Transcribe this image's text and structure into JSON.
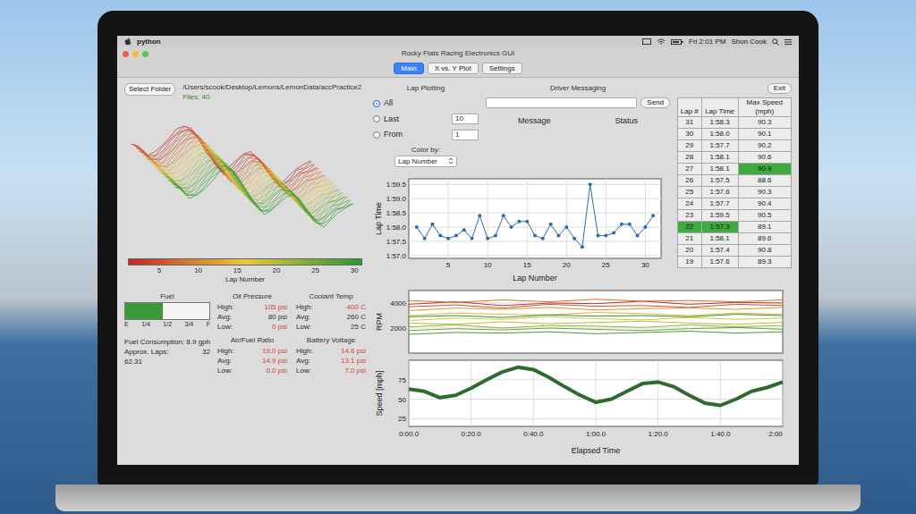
{
  "menubar": {
    "app": "python",
    "clock": "Fri 2:01 PM",
    "user": "Shon Cook"
  },
  "window": {
    "title": "Rocky Flats Racing Electronics GUI"
  },
  "tabs": [
    {
      "label": "Main",
      "selected": true
    },
    {
      "label": "X vs. Y Plot",
      "selected": false
    },
    {
      "label": "Settings",
      "selected": false
    }
  ],
  "folder": {
    "button": "Select Folder",
    "path": "/Users/scook/Desktop/Lemons/LemonData/accPractice2",
    "files": "Files: 40"
  },
  "colorbar": {
    "ticks": [
      "5",
      "10",
      "15",
      "20",
      "25",
      "30"
    ],
    "label": "Lap Number"
  },
  "fuel": {
    "title": "Fuel",
    "level": 0.45,
    "ticks": [
      "E",
      "1/4",
      "1/2",
      "3/4",
      "F"
    ],
    "consumption_label": "Fuel Consumption:",
    "consumption": "8.9 gph",
    "laps_label": "Approx. Laps:",
    "laps": "32",
    "remaining": "62.31"
  },
  "sensors": [
    {
      "title": "Oil Pressure",
      "stats": [
        {
          "label": "High:",
          "value": "105 psi",
          "alert": true
        },
        {
          "label": "Avg:",
          "value": "80 psi",
          "alert": false
        },
        {
          "label": "Low:",
          "value": "0 psi",
          "alert": true
        }
      ]
    },
    {
      "title": "Coolant Temp",
      "stats": [
        {
          "label": "High:",
          "value": "400 C",
          "alert": true
        },
        {
          "label": "Avg:",
          "value": "260 C",
          "alert": false
        },
        {
          "label": "Low:",
          "value": "25 C",
          "alert": false
        }
      ]
    },
    {
      "title": "Air/Fuel Ratio",
      "stats": [
        {
          "label": "High:",
          "value": "19.0 psi",
          "alert": true
        },
        {
          "label": "Avg:",
          "value": "14.9 psi",
          "alert": true
        },
        {
          "label": "Low:",
          "value": "0.0 psi",
          "alert": true
        }
      ]
    },
    {
      "title": "Battery Voltage",
      "stats": [
        {
          "label": "High:",
          "value": "14.6 psi",
          "alert": true
        },
        {
          "label": "Avg:",
          "value": "13.1 psi",
          "alert": true
        },
        {
          "label": "Low:",
          "value": "7.0 psi",
          "alert": true
        }
      ]
    }
  ],
  "lap_plotting": {
    "title": "Lap Plotting",
    "options": [
      {
        "label": "All",
        "selected": true,
        "kind": "plain"
      },
      {
        "label": "Last",
        "selected": false,
        "kind": "spin",
        "value": "10"
      },
      {
        "label": "From",
        "selected": false,
        "kind": "spin",
        "value": "1"
      }
    ],
    "color_by": {
      "label": "Color by:",
      "value": "Lap Number"
    }
  },
  "messaging": {
    "title": "Driver Messaging",
    "send": "Send",
    "columns": [
      "Message",
      "Status"
    ]
  },
  "exit": "Exit",
  "table": {
    "columns": [
      "Lap #",
      "Lap Time",
      "Max Speed (mph)"
    ],
    "rows": [
      {
        "lap": "31",
        "time": "1:58.3",
        "speed": "90.3",
        "best_time": false,
        "best_speed": false
      },
      {
        "lap": "30",
        "time": "1:58.0",
        "speed": "90.1",
        "best_time": false,
        "best_speed": false
      },
      {
        "lap": "29",
        "time": "1:57.7",
        "speed": "90.2",
        "best_time": false,
        "best_speed": false
      },
      {
        "lap": "28",
        "time": "1:58.1",
        "speed": "90.6",
        "best_time": false,
        "best_speed": false
      },
      {
        "lap": "27",
        "time": "1:58.1",
        "speed": "90.9",
        "best_time": false,
        "best_speed": true
      },
      {
        "lap": "26",
        "time": "1:57.5",
        "speed": "88.6",
        "best_time": false,
        "best_speed": false
      },
      {
        "lap": "25",
        "time": "1:57.6",
        "speed": "90.3",
        "best_time": false,
        "best_speed": false
      },
      {
        "lap": "24",
        "time": "1:57.7",
        "speed": "90.4",
        "best_time": false,
        "best_speed": false
      },
      {
        "lap": "23",
        "time": "1:59.5",
        "speed": "90.5",
        "best_time": false,
        "best_speed": false
      },
      {
        "lap": "22",
        "time": "1:57.3",
        "speed": "89.1",
        "best_time": true,
        "best_speed": false
      },
      {
        "lap": "21",
        "time": "1:58.1",
        "speed": "89.6",
        "best_time": false,
        "best_speed": false
      },
      {
        "lap": "20",
        "time": "1:57.4",
        "speed": "90.8",
        "best_time": false,
        "best_speed": false
      },
      {
        "lap": "19",
        "time": "1:57.6",
        "speed": "89.3",
        "best_time": false,
        "best_speed": false
      }
    ]
  },
  "lap_chart": {
    "y_label": "Lap Time",
    "x_label": "Lap Number",
    "y_ticks": [
      "1:57.0",
      "1:57.5",
      "1:58.0",
      "1:58.5",
      "1:59.0",
      "1:59.5"
    ],
    "x_ticks": [
      "5",
      "10",
      "15",
      "20",
      "25",
      "30"
    ],
    "values": [
      118.0,
      117.6,
      118.1,
      117.7,
      117.6,
      117.7,
      117.9,
      117.6,
      118.4,
      117.6,
      117.7,
      118.4,
      118.0,
      118.2,
      118.2,
      117.7,
      117.6,
      118.1,
      117.7,
      118.0,
      117.6,
      117.3,
      119.5,
      117.7,
      117.7,
      117.8,
      118.1,
      118.1,
      117.7,
      118.0,
      118.4
    ]
  },
  "rpm_chart": {
    "y_label": "RPM",
    "y_ticks": [
      "2000",
      "4000"
    ],
    "series": [
      {
        "lap": 2,
        "values": [
          3900,
          4100,
          3800,
          4000,
          3950,
          4150,
          3900,
          4050,
          4000
        ]
      },
      {
        "lap": 5,
        "values": [
          3700,
          3850,
          3600,
          3900,
          3750,
          3800,
          3650,
          3900,
          3800
        ]
      },
      {
        "lap": 8,
        "values": [
          4200,
          4050,
          4250,
          4100,
          4300,
          4150,
          4200,
          4100,
          4250
        ]
      },
      {
        "lap": 11,
        "values": [
          3400,
          3600,
          3500,
          3650,
          3450,
          3550,
          3600,
          3500,
          3650
        ]
      },
      {
        "lap": 14,
        "values": [
          3000,
          3200,
          3100,
          3050,
          3250,
          3150,
          3000,
          3200,
          3100
        ]
      },
      {
        "lap": 17,
        "values": [
          2600,
          2800,
          2700,
          2900,
          2750,
          2650,
          2850,
          2700,
          2800
        ]
      },
      {
        "lap": 20,
        "values": [
          2400,
          2300,
          2500,
          2350,
          2450,
          2550,
          2400,
          2300,
          2450
        ]
      },
      {
        "lap": 23,
        "values": [
          2100,
          2250,
          2000,
          2200,
          2150,
          2050,
          2250,
          2100,
          2200
        ]
      },
      {
        "lap": 26,
        "values": [
          1800,
          1950,
          1850,
          2000,
          1900,
          1800,
          1950,
          2050,
          1900
        ]
      },
      {
        "lap": 29,
        "values": [
          1500,
          1650,
          1600,
          1700,
          1550,
          1650,
          1750,
          1600,
          1700
        ]
      },
      {
        "lap": 31,
        "values": [
          2900,
          3000,
          2850,
          3050,
          2950,
          3000,
          2900,
          3100,
          3000
        ]
      }
    ]
  },
  "speed_chart": {
    "y_label": "Speed [mph]",
    "y_ticks": [
      "25",
      "50",
      "75"
    ],
    "x_ticks": [
      "0:00.0",
      "0:20.0",
      "0:40.0",
      "1:00.0",
      "1:20.0",
      "1:40.0",
      "2:00"
    ],
    "x_label": "Elapsed Time",
    "values": [
      63,
      60,
      52,
      55,
      64,
      75,
      85,
      91,
      88,
      78,
      66,
      55,
      46,
      50,
      60,
      70,
      72,
      66,
      55,
      45,
      42,
      50,
      60,
      65,
      72
    ]
  }
}
